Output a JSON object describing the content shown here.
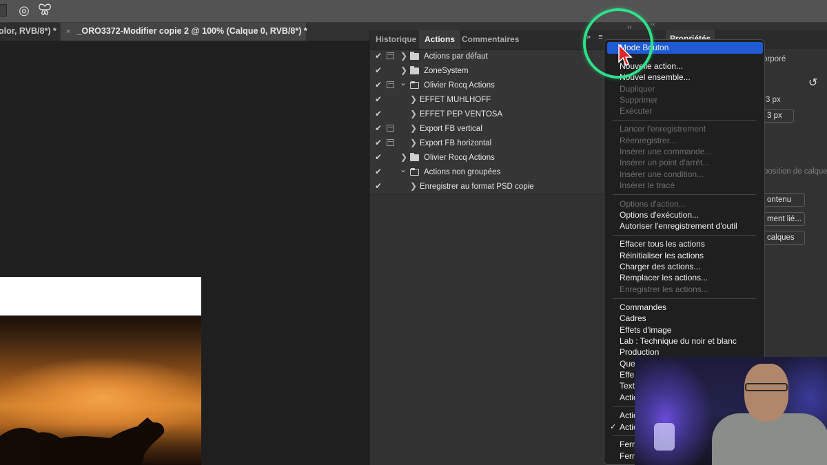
{
  "toolbar": {
    "icons": [
      "target-brush-icon",
      "butterfly-icon"
    ]
  },
  "documents": {
    "tabs": [
      {
        "label": "olor, RVB/8*) *"
      },
      {
        "label": "_ORO3372-Modifier copie 2 @ 100% (Calque 0, RVB/8*) *",
        "close": "×"
      }
    ]
  },
  "actions_panel": {
    "tabs": [
      "Historique",
      "Actions",
      "Commentaires"
    ],
    "active_tab": "Actions",
    "collapse_glyph": "»",
    "menu_glyph": "≡",
    "rows": [
      {
        "label": "Actions par défaut",
        "type": "set",
        "checked": "✔",
        "toggle": "❯"
      },
      {
        "label": "ZoneSystem",
        "type": "set",
        "checked": "✔",
        "toggle": "❯"
      },
      {
        "label": "Olivier Rocq Actions",
        "type": "set-open",
        "checked": "✔",
        "toggle": "⌄"
      },
      {
        "label": "EFFET MUHLHOFF",
        "type": "action",
        "checked": "✔",
        "toggle": "❯"
      },
      {
        "label": "EFFET PEP VENTOSA",
        "type": "action",
        "checked": "✔",
        "toggle": "❯"
      },
      {
        "label": "Export FB vertical",
        "type": "action",
        "checked": "✔",
        "toggle": "❯"
      },
      {
        "label": "Export FB horizontal",
        "type": "action",
        "checked": "✔",
        "toggle": "❯"
      },
      {
        "label": "Olivier Rocq Actions",
        "type": "set",
        "checked": "✔",
        "toggle": "❯"
      },
      {
        "label": "Actions non groupées",
        "type": "set-open",
        "checked": "✔",
        "toggle": "⌄"
      },
      {
        "label": "Enregistrer au format PSD copie",
        "type": "action",
        "checked": "✔",
        "toggle": "❯"
      }
    ]
  },
  "properties_panel": {
    "tab": "Propriétés",
    "collapse_glyph": "‹‹",
    "texts": {
      "incorpore": "orporé",
      "px1": "3 px",
      "px2": "3 px",
      "composition": "position de calques",
      "contenu": "ontenu",
      "element_lie": "ment lié...",
      "calques": "calques"
    }
  },
  "flyout_menu": {
    "highlighted": "Mode Bouton",
    "items": [
      {
        "label": "Nouvelle action...",
        "enabled": true
      },
      {
        "label": "Nouvel ensemble...",
        "enabled": true
      },
      {
        "label": "Dupliquer",
        "enabled": false
      },
      {
        "label": "Supprimer",
        "enabled": false
      },
      {
        "label": "Exécuter",
        "enabled": false
      },
      {
        "label": "Lancer l'enregistrement",
        "enabled": false
      },
      {
        "label": "Réenregistrer...",
        "enabled": false
      },
      {
        "label": "Insérer une commande...",
        "enabled": false
      },
      {
        "label": "Insérer un point d'arrêt...",
        "enabled": false
      },
      {
        "label": "Insérer une condition...",
        "enabled": false
      },
      {
        "label": "Insérer le tracé",
        "enabled": false
      },
      {
        "label": "Options d'action...",
        "enabled": false
      },
      {
        "label": "Options d'exécution...",
        "enabled": true
      },
      {
        "label": "Autoriser l'enregistrement d'outil",
        "enabled": true
      },
      {
        "label": "Effacer tous les actions",
        "enabled": true
      },
      {
        "label": "Réinitialiser les actions",
        "enabled": true
      },
      {
        "label": "Charger des actions...",
        "enabled": true
      },
      {
        "label": "Remplacer les actions...",
        "enabled": true
      },
      {
        "label": "Enregistrer les actions...",
        "enabled": false
      },
      {
        "label": "Commandes",
        "enabled": true
      },
      {
        "label": "Cadres",
        "enabled": true
      },
      {
        "label": "Effets d'image",
        "enabled": true
      },
      {
        "label": "Lab : Technique du noir et blanc",
        "enabled": true
      },
      {
        "label": "Production",
        "enabled": true
      },
      {
        "label": "Que",
        "enabled": true
      },
      {
        "label": "Effe",
        "enabled": true
      },
      {
        "label": "Text",
        "enabled": true
      },
      {
        "label": "Actio",
        "enabled": true
      },
      {
        "label": "Actio",
        "enabled": true
      },
      {
        "label": "Actio",
        "enabled": true,
        "checked": "✓"
      },
      {
        "label": "Ferm",
        "enabled": true
      },
      {
        "label": "Ferm",
        "enabled": true
      }
    ]
  },
  "colors": {
    "highlight": "#1e5bd3",
    "ring": "#2fe08a",
    "cursor": "#e0242b"
  }
}
